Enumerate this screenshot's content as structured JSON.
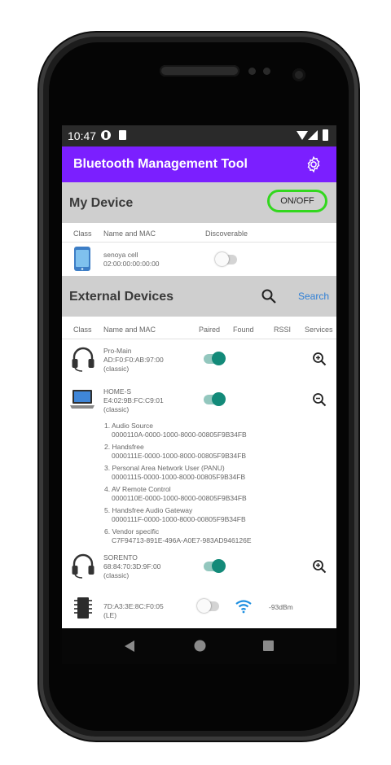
{
  "status_bar": {
    "time": "10:47"
  },
  "app_bar": {
    "title": "Bluetooth Management Tool",
    "settings_icon": "gear-icon"
  },
  "my_device": {
    "title": "My Device",
    "toggle_label": "ON/OFF",
    "toggle_border_color": "#32d71e",
    "columns": [
      "Class",
      "Name and MAC",
      "Discoverable"
    ],
    "device": {
      "icon": "phone-icon",
      "name": "senoya cell",
      "mac": "02:00:00:00:00:00",
      "discoverable": false
    }
  },
  "external": {
    "title": "External Devices",
    "search_label": "Search",
    "columns": [
      "Class",
      "Name and MAC",
      "Paired",
      "Found",
      "RSSI",
      "Services"
    ],
    "devices": [
      {
        "icon": "headset-icon",
        "name": "Pro-Main",
        "mac": "AD:F0:F0:AB:97:00",
        "type": "(classic)",
        "paired": true,
        "services_icon": "zoom-in-icon"
      },
      {
        "icon": "laptop-icon",
        "name": "HOME-S",
        "mac": "E4:02:9B:FC:C9:01",
        "type": "(classic)",
        "paired": true,
        "services_icon": "zoom-out-icon",
        "services": [
          {
            "label": "1. Audio Source",
            "uuid": "0000110A-0000-1000-8000-00805F9B34FB"
          },
          {
            "label": "2. Handsfree",
            "uuid": "0000111E-0000-1000-8000-00805F9B34FB"
          },
          {
            "label": "3. Personal Area Network User (PANU)",
            "uuid": "00001115-0000-1000-8000-00805F9B34FB"
          },
          {
            "label": "4. AV Remote Control",
            "uuid": "0000110E-0000-1000-8000-00805F9B34FB"
          },
          {
            "label": "5. Handsfree Audio Gateway",
            "uuid": "0000111F-0000-1000-8000-00805F9B34FB"
          },
          {
            "label": "6. Vendor specific",
            "uuid": "C7F94713-891E-496A-A0E7-983AD946126E"
          }
        ]
      },
      {
        "icon": "headset-icon",
        "name": "SORENTO",
        "mac": "68:84:70:3D:9F:00",
        "type": "(classic)",
        "paired": true,
        "services_icon": "zoom-in-icon"
      },
      {
        "icon": "chip-icon",
        "name": "",
        "mac": "7D:A3:3E:8C:F0:05",
        "type": "(LE)",
        "paired": false,
        "found_icon": "wifi-icon",
        "rssi": "-93dBm"
      }
    ]
  },
  "nav": {
    "back": "back-icon",
    "home": "home-icon",
    "recents": "recents-icon"
  },
  "colors": {
    "app_bar": "#7b1fff",
    "section_bg": "#cfcfcf",
    "toggle_on": "#138a79",
    "link": "#2f7fd6"
  }
}
